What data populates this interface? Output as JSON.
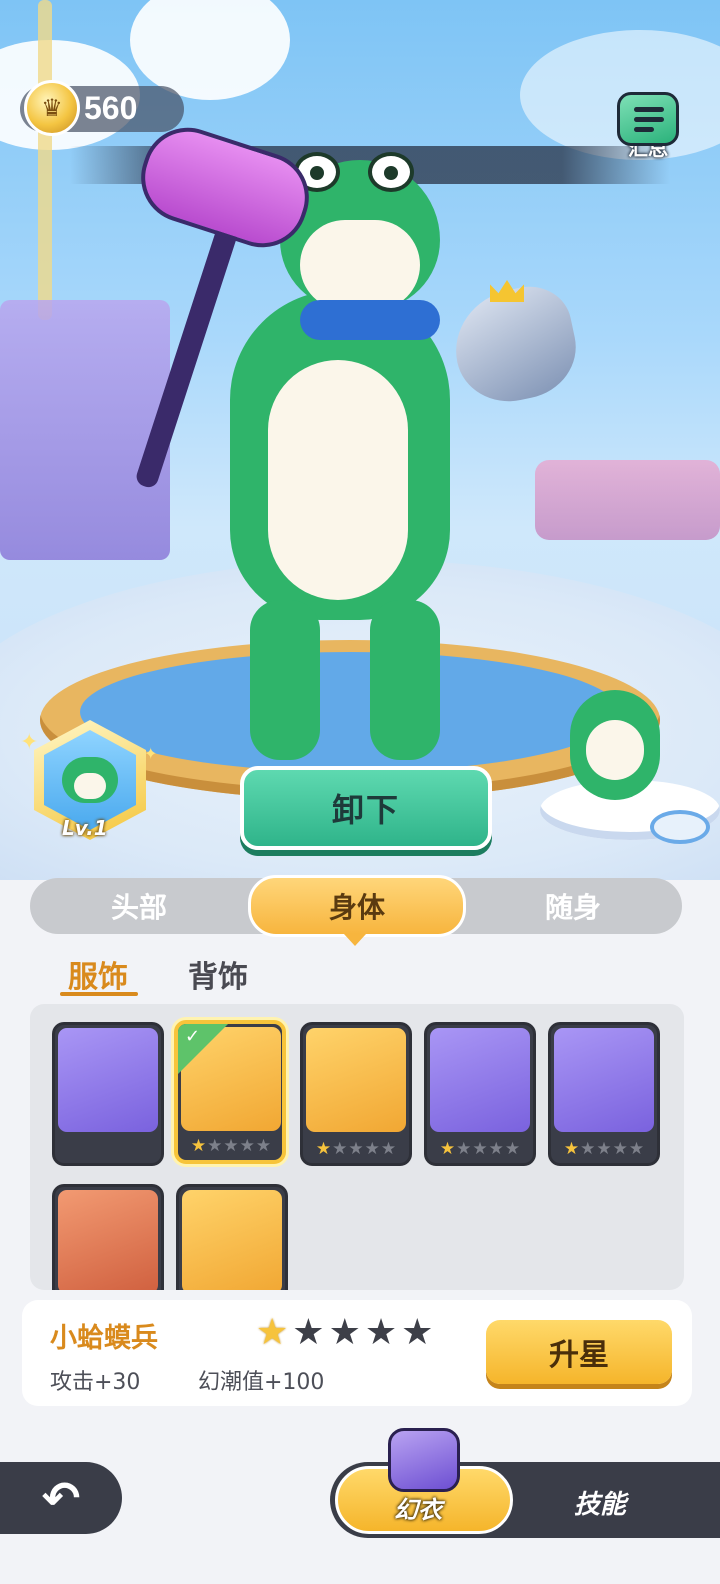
{
  "currency": {
    "icon": "king-coin-icon",
    "value": "560"
  },
  "summary": {
    "label": "汇总",
    "icon": "summary-list-icon"
  },
  "character": {
    "level": "Lv.1"
  },
  "unequip_label": "卸下",
  "category_tabs": [
    {
      "label": "头部",
      "active": false
    },
    {
      "label": "身体",
      "active": true
    },
    {
      "label": "随身",
      "active": false
    }
  ],
  "sub_tabs": [
    {
      "label": "服饰",
      "active": true
    },
    {
      "label": "背饰",
      "active": false
    }
  ],
  "outfits": [
    {
      "icon": "blue-jacket-icon",
      "stars": null,
      "selected": false,
      "color": "#9b88f0"
    },
    {
      "icon": "frog-costume-icon",
      "stars": 1,
      "selected": true,
      "color": "#f6b73e"
    },
    {
      "icon": "leaf-outfit-icon",
      "stars": 1,
      "selected": false,
      "color": "#f6b73e"
    },
    {
      "icon": "hoodie-icon",
      "stars": 1,
      "selected": false,
      "color": "#9b88f0"
    },
    {
      "icon": "overalls-icon",
      "stars": 1,
      "selected": false,
      "color": "#9b88f0"
    },
    {
      "icon": "robe-icon",
      "stars": null,
      "selected": false,
      "color": "#e07a56"
    },
    {
      "icon": "space-suit-icon",
      "stars": null,
      "selected": false,
      "color": "#f6b73e"
    }
  ],
  "selected_item": {
    "name": "小蛤蟆兵",
    "stars_filled": 1,
    "stars_total": 5,
    "stats": [
      "攻击+30",
      "幻潮值+100"
    ],
    "upgrade_label": "升星"
  },
  "bottom_nav": {
    "back_icon": "back-arrow-icon",
    "tabs": [
      {
        "label": "幻衣",
        "active": true
      },
      {
        "label": "技能",
        "active": false
      }
    ]
  }
}
